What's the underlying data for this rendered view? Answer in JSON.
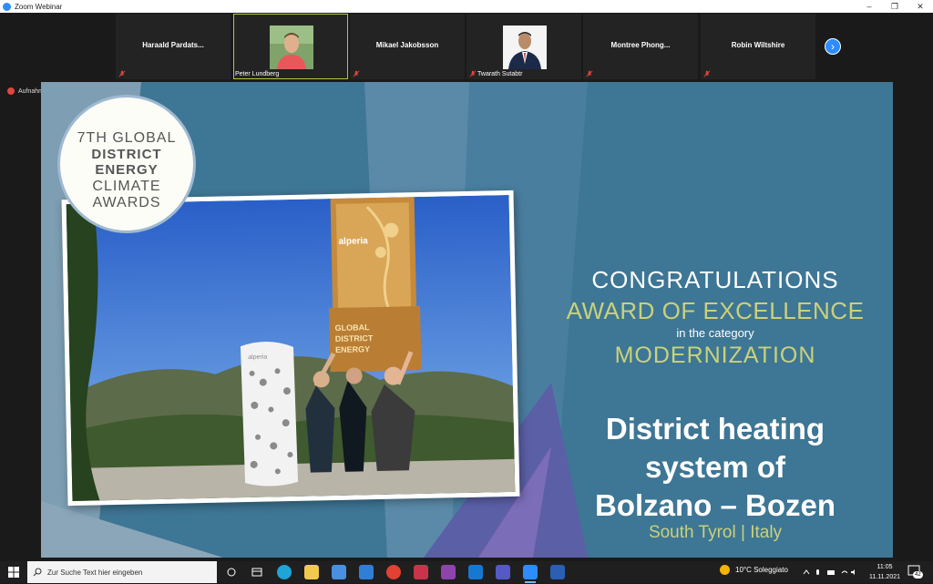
{
  "window": {
    "title": "Zoom Webinar",
    "controls": {
      "minimize": "–",
      "restore": "❐",
      "close": "✕"
    }
  },
  "gallery": {
    "participants": [
      {
        "name": "Haraald  Pardats...",
        "has_video": false,
        "muted": true
      },
      {
        "name": "Peter Lundberg",
        "has_video": true,
        "muted": false
      },
      {
        "name": "Mikael Jakobsson",
        "has_video": false,
        "muted": true
      },
      {
        "name": "Twarath Sutabtr",
        "has_video": true,
        "muted": true
      },
      {
        "name": "Montree  Phong...",
        "has_video": false,
        "muted": true
      },
      {
        "name": "Robin Wiltshire",
        "has_video": false,
        "muted": true
      }
    ],
    "next_arrow": "›"
  },
  "recording": {
    "label": "Aufnahme"
  },
  "slide": {
    "logo": {
      "line1": "7TH GLOBAL",
      "line2": "DISTRICT",
      "line3": "ENERGY",
      "line4": "CLIMATE",
      "line5": "AWARDS"
    },
    "photo": {
      "trophy_brand": "alperia",
      "tower_brand": "alperia"
    },
    "congrats": "CONGRATULATIONS",
    "award": "AWARD OF EXCELLENCE",
    "category_intro": "in the category",
    "category": "MODERNIZATION",
    "project_line1": "District heating",
    "project_line2": "system of",
    "project_line3": "Bolzano – Bozen",
    "location": "South Tyrol | Italy",
    "colors": {
      "background": "#3e7695",
      "accent": "#c9d27a"
    }
  },
  "taskbar": {
    "search_placeholder": "Zur Suche Text hier eingeben",
    "weather": "10°C  Soleggiato",
    "time": "11:05",
    "date": "11.11.2021",
    "notification_count": "42",
    "apps": [
      {
        "name": "task-view",
        "color": "#2b2b2b"
      },
      {
        "name": "edge",
        "color": "#1fa4d8"
      },
      {
        "name": "file-explorer",
        "color": "#f2c94c"
      },
      {
        "name": "store",
        "color": "#4a90e2"
      },
      {
        "name": "mail",
        "color": "#2f7fd8"
      },
      {
        "name": "chrome",
        "color": "#e34133"
      },
      {
        "name": "d3",
        "color": "#c9344b"
      },
      {
        "name": "onenote",
        "color": "#8e44ad"
      },
      {
        "name": "outlook",
        "color": "#1778d2"
      },
      {
        "name": "teams",
        "color": "#5559c6"
      },
      {
        "name": "zoom",
        "color": "#2d8cff"
      },
      {
        "name": "word",
        "color": "#2b5fb3"
      }
    ]
  }
}
